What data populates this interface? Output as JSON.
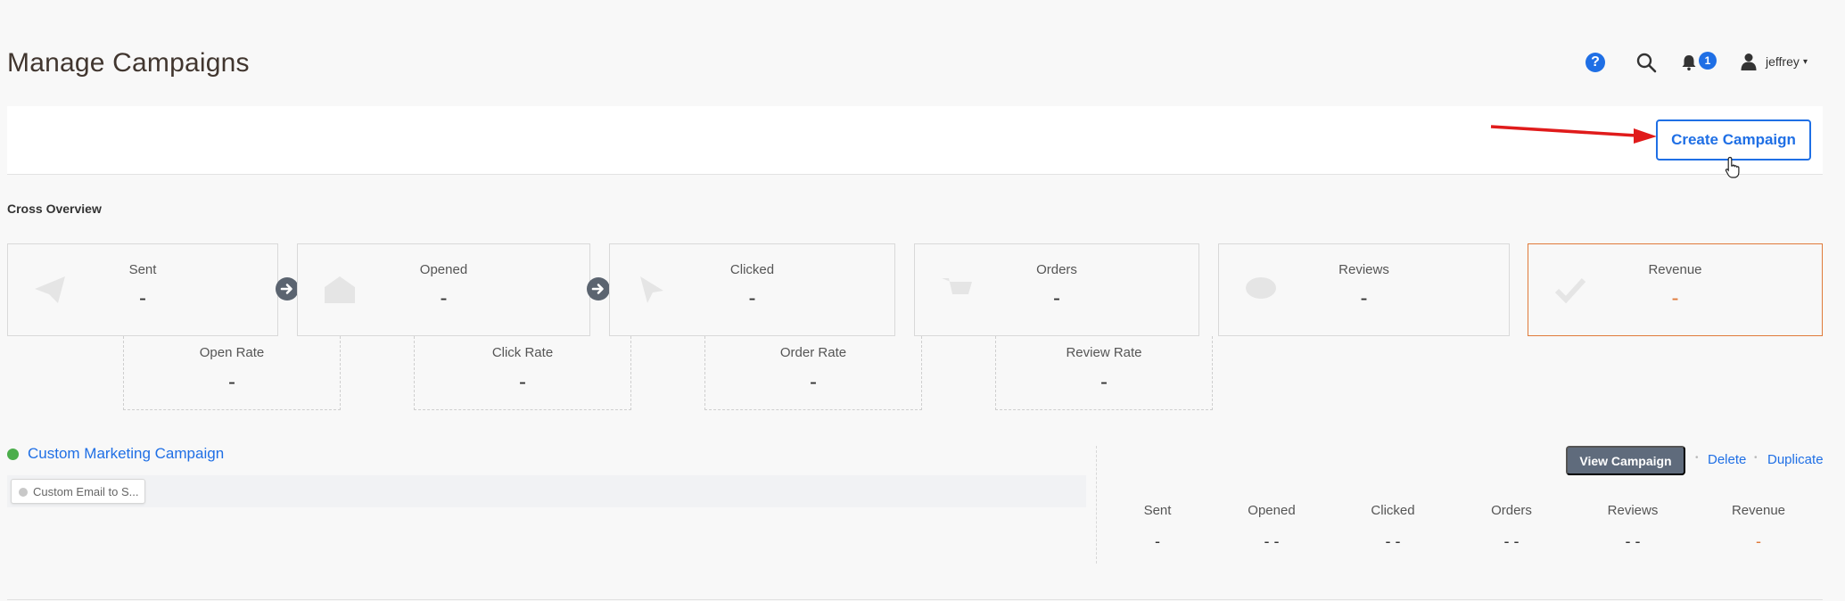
{
  "header": {
    "title": "Manage Campaigns",
    "help_label": "?",
    "notification_count": "1",
    "user_name": "jeffrey",
    "user_caret": "▾"
  },
  "toolbar": {
    "create_label": "Create Campaign"
  },
  "overview": {
    "section_label": "Cross Overview",
    "stats": [
      {
        "label": "Sent",
        "value": "-"
      },
      {
        "label": "Opened",
        "value": "-"
      },
      {
        "label": "Clicked",
        "value": "-"
      },
      {
        "label": "Orders",
        "value": "-"
      },
      {
        "label": "Reviews",
        "value": "-"
      },
      {
        "label": "Revenue",
        "value": "-"
      }
    ],
    "rates": [
      {
        "label": "Open Rate",
        "value": "-"
      },
      {
        "label": "Click Rate",
        "value": "-"
      },
      {
        "label": "Order Rate",
        "value": "-"
      },
      {
        "label": "Review Rate",
        "value": "-"
      }
    ]
  },
  "campaign": {
    "name": "Custom Marketing Campaign",
    "step_label": "Custom Email to S...",
    "view_label": "View Campaign",
    "delete_label": "Delete",
    "duplicate_label": "Duplicate",
    "separator": "•",
    "stats": [
      {
        "label": "Sent",
        "value": "-"
      },
      {
        "label": "Opened",
        "value": "- -"
      },
      {
        "label": "Clicked",
        "value": "- -"
      },
      {
        "label": "Orders",
        "value": "- -"
      },
      {
        "label": "Reviews",
        "value": "- -"
      },
      {
        "label": "Revenue",
        "value": "-"
      }
    ]
  },
  "colors": {
    "accent": "#1f6fe5",
    "revenue": "#e07a3a",
    "active_status": "#4cae4c",
    "annotation_arrow": "#e01b1b"
  },
  "icons": {
    "help": "help-icon",
    "search": "search-icon",
    "notifications": "bell-icon",
    "user": "user-icon",
    "flow_arrow": "arrow-right-circle-icon"
  }
}
